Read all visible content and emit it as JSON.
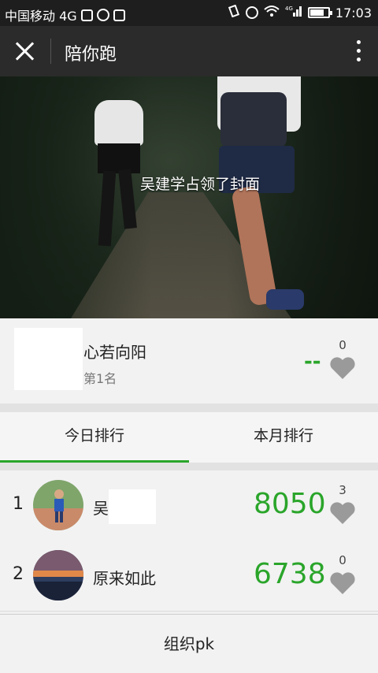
{
  "status_bar": {
    "carrier": "中国移动 4G",
    "network": "4G",
    "time": "17:03",
    "battery_level": 0.8
  },
  "navbar": {
    "title": "陪你跑"
  },
  "cover": {
    "caption": "吴建学占领了封面"
  },
  "me": {
    "name": "心若向阳",
    "rank": "第1名",
    "score": "--",
    "likes": "0"
  },
  "tabs": [
    {
      "label": "今日排行",
      "active": true
    },
    {
      "label": "本月排行",
      "active": false
    }
  ],
  "ranking": [
    {
      "rank": "1",
      "name": "吴",
      "score": "8050",
      "likes": "3"
    },
    {
      "rank": "2",
      "name": "原来如此",
      "score": "6738",
      "likes": "0"
    }
  ],
  "footer": {
    "button_label": "组织pk"
  },
  "colors": {
    "accent_green": "#2aa52a",
    "navbar_bg": "#2b2b2b",
    "heart_gray": "#9a9a9a"
  }
}
